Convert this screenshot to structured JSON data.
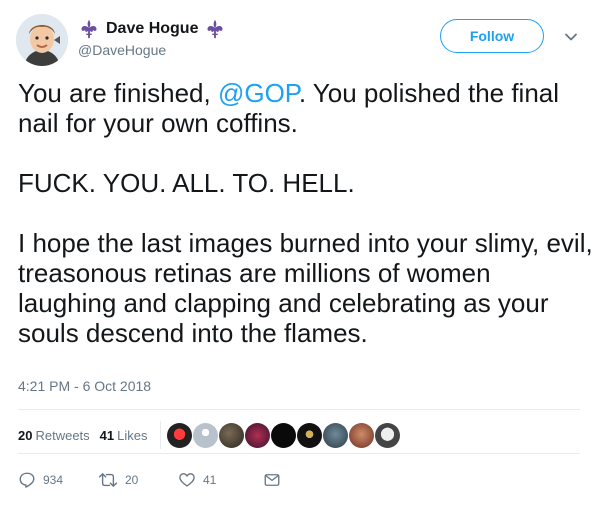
{
  "user": {
    "display_name": "Dave Hogue",
    "handle": "@DaveHogue",
    "badge_icon": "fleur-de-lis-icon",
    "badge_color": "#6b4fa0"
  },
  "follow_label": "Follow",
  "tweet": {
    "line1_before": "You are finished, ",
    "mention": "@GOP",
    "line1_after": ". You polished the final nail for your own coffins.",
    "paragraph2": "FUCK. YOU. ALL. TO. HELL.",
    "paragraph3": "I hope the last images burned into your slimy, evil, treasonous retinas are millions of women laughing and clapping and celebrating as your souls descend into the flames."
  },
  "timestamp": "4:21 PM - 6 Oct 2018",
  "stats": {
    "retweets_count": "20",
    "retweets_label": "Retweets",
    "likes_count": "41",
    "likes_label": "Likes"
  },
  "actions": {
    "reply_count": "934",
    "retweet_count": "20",
    "like_count": "41"
  },
  "colors": {
    "accent": "#1da1f2",
    "muted": "#657786",
    "text": "#14171a"
  }
}
